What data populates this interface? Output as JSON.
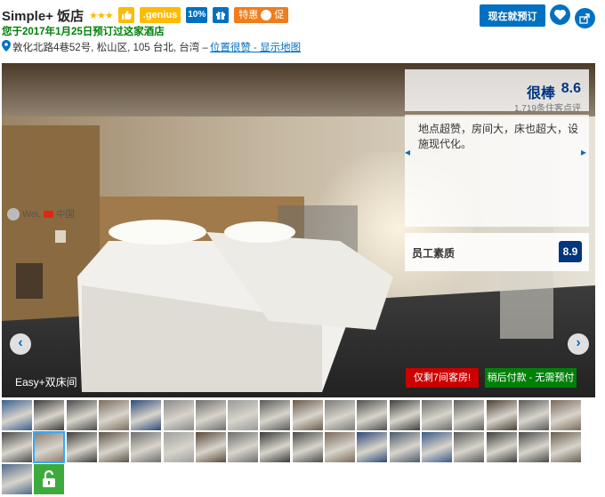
{
  "hotel": {
    "name": "Simple+ 饭店",
    "stars": "★★★",
    "genius_label": ".genius",
    "discount_label": "10%",
    "promo_label": "特惠",
    "promo_suffix": "促",
    "booked_note": "您于2017年1月25日预订过这家酒店",
    "address": "敦化北路4巷52号, 松山区, 105 台北, 台湾 – ",
    "location_link": "位置很赞 - 显示地图"
  },
  "actions": {
    "reserve_label": "现在就预订"
  },
  "photo": {
    "caption": "Easy+双床间",
    "prev_label": "‹",
    "next_label": "›",
    "alert_rooms": "仅剩7间客房!",
    "alert_pay": "稍后付款 - 无需预付"
  },
  "review": {
    "word": "很棒",
    "score": "8.6",
    "count": "1,719条住客点评",
    "quote": "地点超赞，房间大，床也超大，设施现代化。",
    "reviewer_name": "Wei,",
    "reviewer_country": "中国",
    "nav_prev": "◂",
    "nav_next": "▸",
    "staff_label": "员工素质",
    "staff_score": "8.9"
  },
  "colors": {
    "brand_blue": "#0071c2",
    "dark_blue": "#003580",
    "genius_yellow": "#febb02",
    "promo_orange": "#f07c1b",
    "success_green": "#008009",
    "alert_red": "#cc0000"
  },
  "thumbnails": [
    {
      "tone": "#3a5f8f"
    },
    {
      "tone": "#3a3a3a"
    },
    {
      "tone": "#4a4a4a"
    },
    {
      "tone": "#7a6e5e"
    },
    {
      "tone": "#2e4a7a"
    },
    {
      "tone": "#8a8a8a"
    },
    {
      "tone": "#6e6e6e"
    },
    {
      "tone": "#9a9a9a"
    },
    {
      "tone": "#5a5a5a"
    },
    {
      "tone": "#6a5a4a"
    },
    {
      "tone": "#7a7a7a"
    },
    {
      "tone": "#4e4e4e"
    },
    {
      "tone": "#3e3e3e"
    },
    {
      "tone": "#6a6a6a"
    },
    {
      "tone": "#5e5e5e"
    },
    {
      "tone": "#4a3e32"
    },
    {
      "tone": "#5a5a5a"
    },
    {
      "tone": "#7a6a5a"
    },
    {
      "tone": "#4a4a4a"
    },
    {
      "tone": "#8a7a6a"
    },
    {
      "tone": "#3e3e3e"
    },
    {
      "tone": "#5e5448"
    },
    {
      "tone": "#6e6e6e"
    },
    {
      "tone": "#a0a0a0"
    },
    {
      "tone": "#5a4a3a"
    },
    {
      "tone": "#6e6e6e"
    },
    {
      "tone": "#3a3a3a"
    },
    {
      "tone": "#4a4a4a"
    },
    {
      "tone": "#7a6a5a"
    },
    {
      "tone": "#2e4a7a"
    },
    {
      "tone": "#4a5a6a"
    },
    {
      "tone": "#3a5a8a"
    },
    {
      "tone": "#5a5a5a"
    },
    {
      "tone": "#3e3e3e"
    },
    {
      "tone": "#4a4a4a"
    },
    {
      "tone": "#6a5e50"
    },
    {
      "tone": "#4e6a8a"
    }
  ]
}
